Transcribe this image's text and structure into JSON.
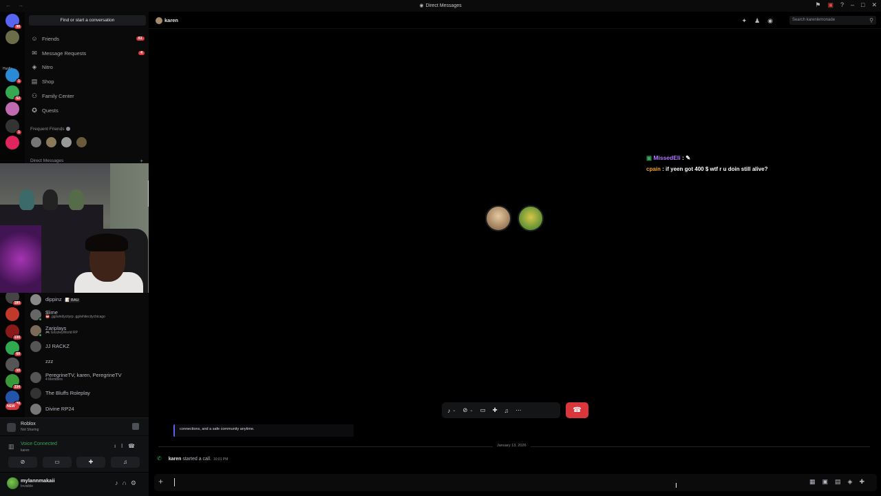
{
  "window": {
    "title": "Direct Messages",
    "nav_arrows": "← →",
    "title_icon": "discord-icon"
  },
  "titlebar_icons": [
    "inbox-icon",
    "screen-icon",
    "help-icon",
    "minimize",
    "maximize",
    "close"
  ],
  "rail": {
    "servers": [
      {
        "name": "home",
        "badge": "98",
        "color": "#5865f2"
      },
      {
        "name": "server-2",
        "badge": "",
        "color": "#6a6d48"
      },
      {
        "name": "server-3",
        "badge": "",
        "color": "#222"
      },
      {
        "name": "server-4",
        "badge": "1",
        "color": "#2a8ad5"
      },
      {
        "name": "server-5",
        "badge": "52",
        "color": "#36a852"
      },
      {
        "name": "server-6",
        "badge": "",
        "color": "#c06ab0"
      },
      {
        "name": "server-7",
        "badge": "1",
        "color": "#333"
      },
      {
        "name": "server-8",
        "badge": "",
        "color": "#e0245e"
      }
    ],
    "lower_servers": [
      {
        "name": "server-9",
        "badge": "180",
        "color": "#444"
      },
      {
        "name": "server-10",
        "badge": "",
        "color": "#c0392b"
      },
      {
        "name": "server-11",
        "badge": "130",
        "color": "#8a1a1a"
      },
      {
        "name": "server-12",
        "badge": "68",
        "color": "#2fa84f"
      },
      {
        "name": "server-13",
        "badge": "10",
        "color": "#555"
      },
      {
        "name": "server-14",
        "badge": "334",
        "color": "#3a9a3a"
      },
      {
        "name": "server-15",
        "badge": "39",
        "color": "#2255aa"
      },
      {
        "name": "server-16",
        "badge": "NEW",
        "color": "#da373c"
      }
    ],
    "small_text": "Hustle"
  },
  "sidebar": {
    "find_label": "Find or start a conversation",
    "nav": [
      {
        "label": "Friends",
        "count": "61",
        "icon": "friends-icon"
      },
      {
        "label": "Message Requests",
        "count": "4",
        "icon": "envelope-icon"
      },
      {
        "label": "Nitro",
        "count": "",
        "icon": "nitro-icon"
      },
      {
        "label": "Shop",
        "count": "",
        "icon": "shop-icon"
      },
      {
        "label": "Family Center",
        "count": "",
        "icon": "family-icon"
      },
      {
        "label": "Quests",
        "count": "",
        "icon": "quests-icon"
      }
    ],
    "frequent_label": "Frequent Friends",
    "dm_header": "Direct Messages",
    "dms": [
      {
        "name": "dippinz",
        "tag": "📝 BAU",
        "sub": "",
        "online": true
      },
      {
        "name": "$lime",
        "tag": "",
        "sub": "📛 .gg/windycityrp .gg/whitecitychicago",
        "online": true
      },
      {
        "name": "Zariplays",
        "tag": "",
        "sub": "🎮 GrizzleyWorld RP",
        "online": true
      },
      {
        "name": "JJ RACKZ",
        "tag": "",
        "sub": "",
        "online": false
      },
      {
        "name": "zzz",
        "tag": "",
        "sub": "",
        "online": false
      },
      {
        "name": "PeregrineTV, karen, PeregrineTV",
        "tag": "",
        "sub": "4 Members",
        "online": false
      },
      {
        "name": "The Bluffs Roleplay",
        "tag": "",
        "sub": "",
        "online": false
      },
      {
        "name": "Divine RP24",
        "tag": "",
        "sub": "",
        "online": false
      }
    ]
  },
  "activity": {
    "title": "Roblox",
    "subtitle": "Not Sharing"
  },
  "voice": {
    "status": "Voice Connected",
    "channel": "karen"
  },
  "user": {
    "name": "mylannmakaii",
    "status": "Invisible"
  },
  "main": {
    "header_title": "karen",
    "search_placeholder": "Search karenlemonade",
    "chat_overlay": {
      "user1": "MissedEli",
      "user2": "cpain",
      "message": "if yeen got 400 $ wtf r u doin still alive?"
    },
    "embed_text": "connections, and a safe community anytime.",
    "date_divider": "January 13, 2026",
    "system_msg": {
      "user": "karen",
      "text": "started a call.",
      "time": "10:01 PM"
    }
  }
}
